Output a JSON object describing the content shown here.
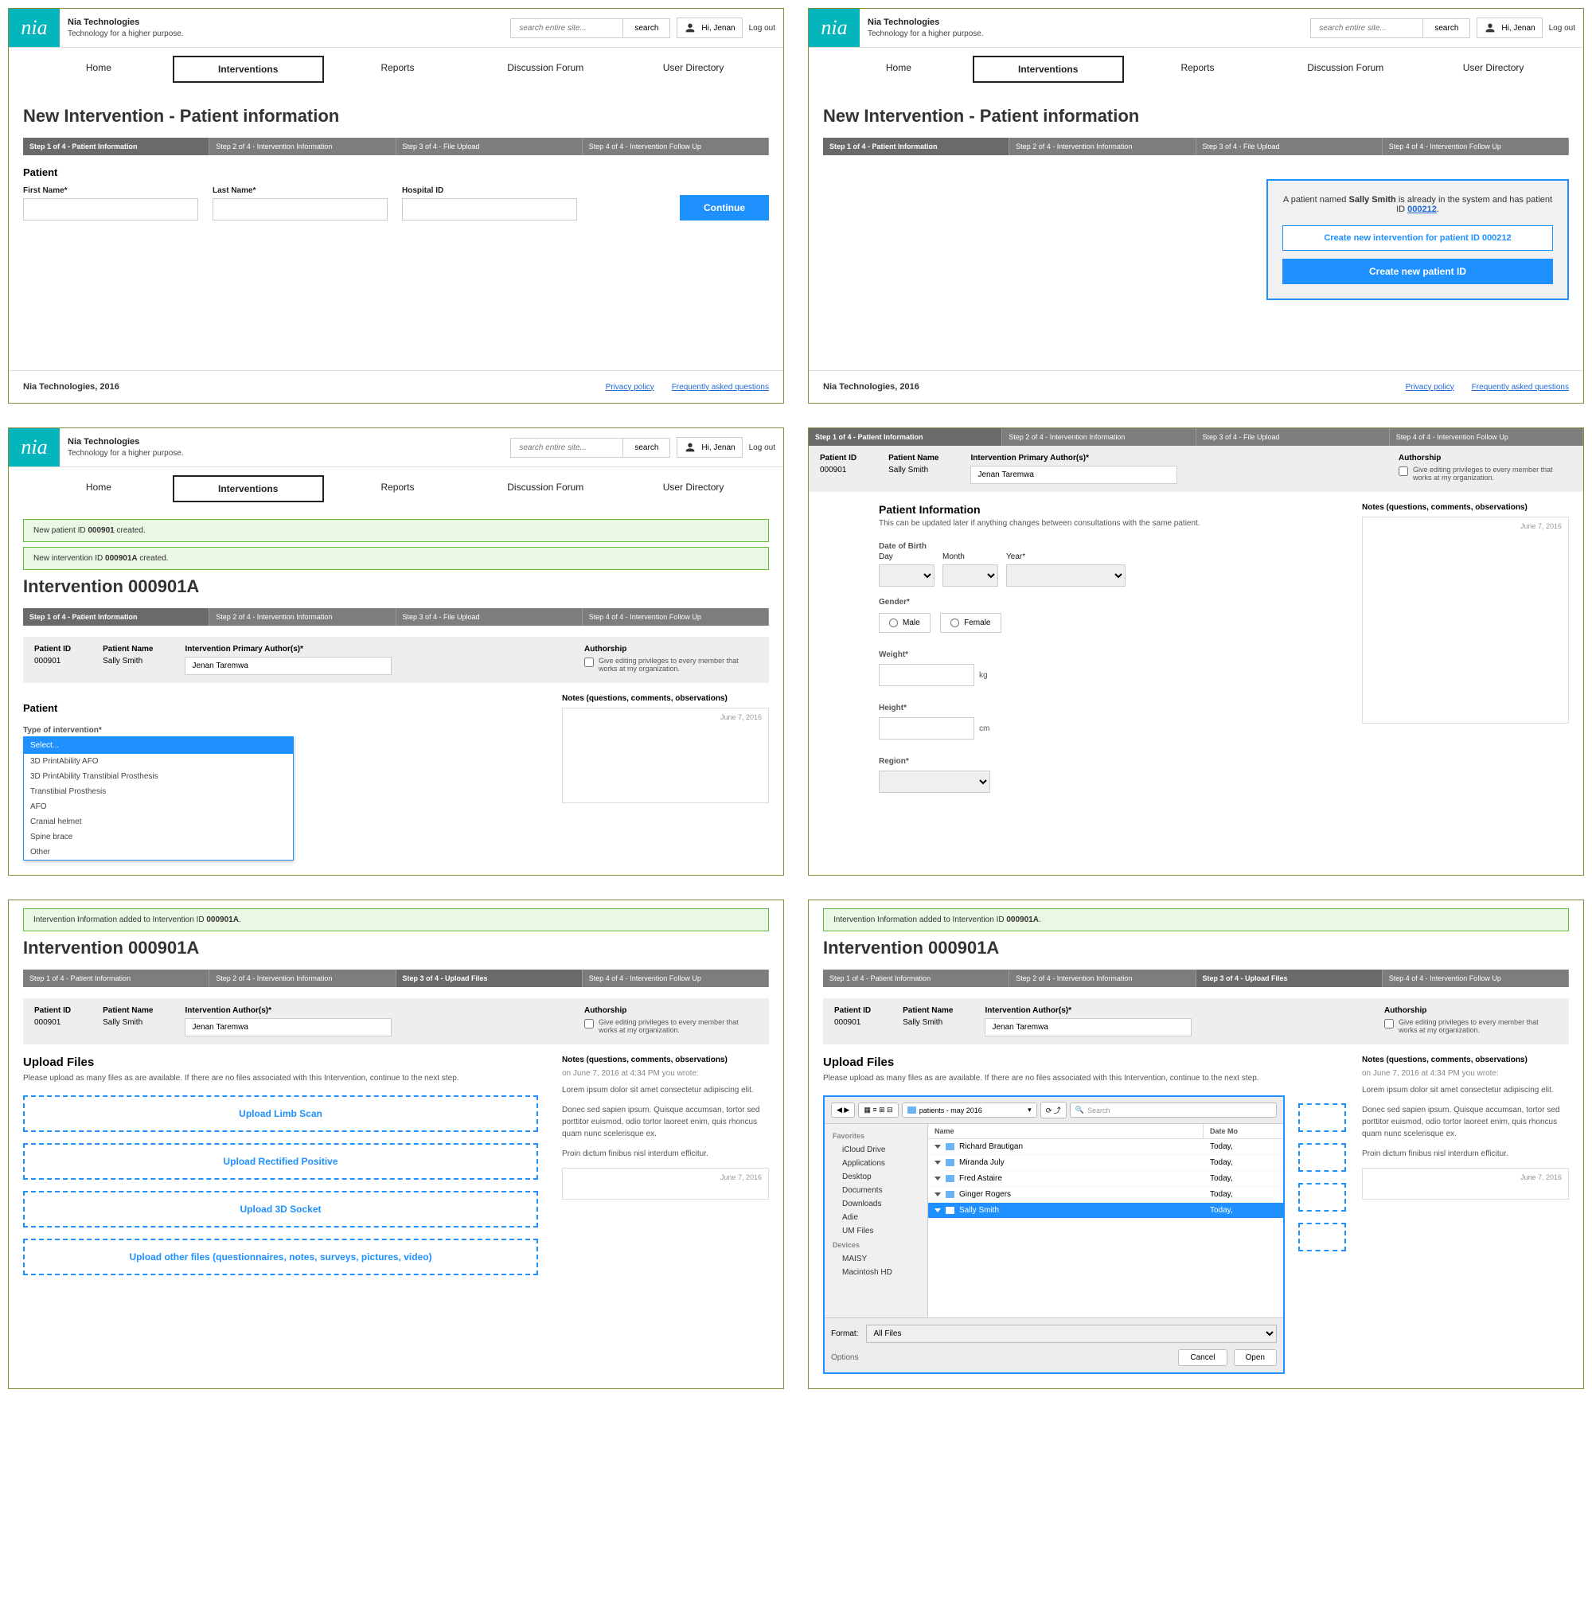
{
  "brand": {
    "name": "Nia Technologies",
    "tag": "Technology for a higher purpose.",
    "logo": "nia"
  },
  "header": {
    "search_ph": "search entire site...",
    "search_btn": "search",
    "greeting": "Hi, Jenan",
    "logout": "Log out"
  },
  "nav": {
    "items": [
      "Home",
      "Interventions",
      "Reports",
      "Discussion Forum",
      "User Directory"
    ]
  },
  "footer": {
    "company": "Nia Technologies, 2016",
    "privacy": "Privacy policy",
    "faq": "Frequently asked questions"
  },
  "steps": {
    "s1": "Step 1 of 4 - Patient Information",
    "s2": "Step 2 of 4 - Intervention Information",
    "s3": "Step 3 of 4 - File Upload",
    "s3b": "Step 3 of 4 - Upload Files",
    "s4": "Step 4 of 4 - Intervention Follow Up"
  },
  "p1": {
    "title": "New Intervention - Patient information",
    "section": "Patient",
    "fn": "First Name*",
    "ln": "Last Name*",
    "hid": "Hospital ID",
    "cont": "Continue"
  },
  "p2": {
    "msg_a": "A patient named ",
    "name": "Sally Smith",
    "msg_b": " is already in the system and has patient ID ",
    "pid": "000212",
    "msg_c": ".",
    "btn1": "Create new intervention for patient ID 000212",
    "btn2": "Create new patient ID"
  },
  "p3": {
    "succ1_a": "New patient ID ",
    "succ1_b": "000901",
    "succ1_c": " created.",
    "succ2_a": "New intervention ID ",
    "succ2_b": "000901A",
    "succ2_c": " created.",
    "title": "Intervention 000901A",
    "pid_lbl": "Patient ID",
    "pid": "000901",
    "pname_lbl": "Patient Name",
    "pname": "Sally Smith",
    "auth_lbl": "Intervention Primary Author(s)*",
    "auth": "Jenan Taremwa",
    "ash_lbl": "Authorship",
    "ash_txt": "Give editing privileges to every member that works at my organization.",
    "section": "Patient",
    "type_lbl": "Type of intervention*",
    "notes_lbl": "Notes (questions, comments, observations)",
    "date": "June 7, 2016",
    "opts": [
      "Select...",
      "3D PrintAbility AFO",
      "3D PrintAbility Transtibial Prosthesis",
      "Transtibial Prosthesis",
      "AFO",
      "Cranial helmet",
      "Spine brace",
      "Other"
    ]
  },
  "p4": {
    "pi_title": "Patient Information",
    "pi_sub": "This can be updated later if anything changes between consultations with the same patient.",
    "dob": "Date of Birth",
    "day": "Day",
    "month": "Month",
    "year": "Year*",
    "gender": "Gender*",
    "male": "Male",
    "female": "Female",
    "weight": "Weight*",
    "kg": "kg",
    "height": "Height*",
    "cm": "cm",
    "region": "Region*"
  },
  "p5": {
    "succ_a": "Intervention Information added to Intervention ID ",
    "succ_b": "000901A",
    "succ_c": ".",
    "title": "Intervention 000901A",
    "auth_lbl": "Intervention Author(s)*",
    "upl_title": "Upload Files",
    "upl_desc": "Please upload as many files as are available. If there are no files associated with this Intervention, continue to the next step.",
    "b1": "Upload Limb Scan",
    "b2": "Upload Rectified Positive",
    "b3": "Upload 3D Socket",
    "b4": "Upload other files (questionnaires, notes, surveys, pictures, video)",
    "n_meta": "on June 7, 2016 at 4:34 PM you wrote:",
    "n1": "Lorem ipsum dolor sit amet consectetur adipiscing elit.",
    "n2": "Donec sed sapien ipsum. Quisque accumsan, tortor sed porttitor euismod, odio tortor laoreet enim, quis rhoncus quam nunc scelerisque ex.",
    "n3": "Proin dictum finibus nisl interdum efficitur."
  },
  "p6": {
    "path": "patients - may 2016",
    "srch_ph": "Search",
    "fav": "Favorites",
    "dev": "Devices",
    "side": [
      "iCloud Drive",
      "Applications",
      "Desktop",
      "Documents",
      "Downloads",
      "Adie",
      "UM Files"
    ],
    "side2": [
      "MAISY",
      "Macintosh HD"
    ],
    "col1": "Name",
    "col2": "Date Mo",
    "rows": [
      [
        "Richard Brautigan",
        "Today,"
      ],
      [
        "Miranda July",
        "Today,"
      ],
      [
        "Fred Astaire",
        "Today,"
      ],
      [
        "Ginger Rogers",
        "Today,"
      ],
      [
        "Sally Smith",
        "Today,"
      ]
    ],
    "fmt_lbl": "Format:",
    "fmt": "All Files",
    "options": "Options",
    "cancel": "Cancel",
    "open": "Open"
  }
}
